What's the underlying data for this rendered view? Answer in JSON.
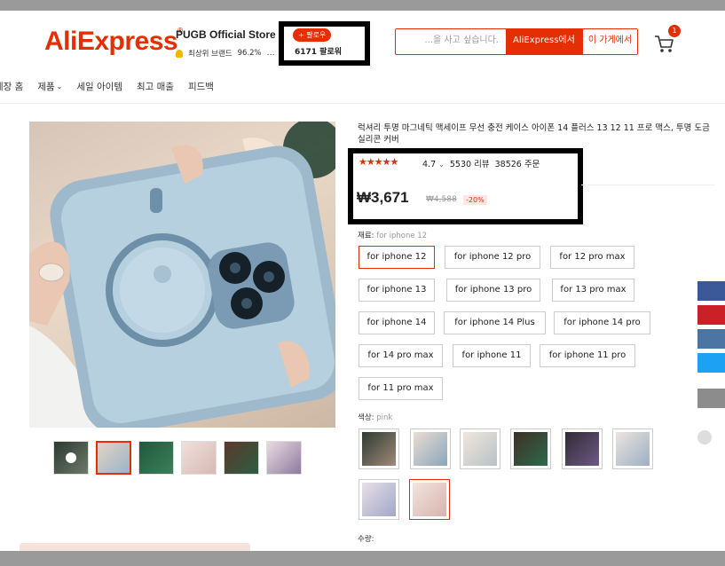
{
  "header": {
    "logo": "AliExpress",
    "store_name": "PUGB Official Store",
    "store_badge_text": "최상위 브랜드",
    "store_rating": "96.2%",
    "follow_label": "+ 팔로우",
    "followers": "6171 팔로워",
    "search_placeholder": "...을 사고 싶습니다.",
    "search_all": "AliExpress에서",
    "search_store": "이 가게에서",
    "cart_count": "1"
  },
  "nav": {
    "items": [
      "게장 홈",
      "제품",
      "세일 아이템",
      "최고 매출",
      "피드백"
    ]
  },
  "product": {
    "title": "럭셔리 투명 마그네틱 맥세이프 무선 충전 케이스 아이폰 14 플러스 13 12 11 프로 맥스, 투명 도금 실리콘 커버",
    "stars": "★★★★★",
    "rating": "4.7",
    "reviews": "5530 리뷰",
    "orders": "38526 주문",
    "price": "₩3,671",
    "old_price": "₩4,588",
    "discount": "-20%",
    "material_label": "재료:",
    "material_value": "for iphone 12",
    "materials": [
      "for iphone 12",
      "for iphone 12 pro",
      "for 12 pro max",
      "for iphone 13",
      "for iphone 13 pro",
      "for 13 pro max",
      "for iphone 14",
      "for iphone 14 Plus",
      "for iphone 14 pro",
      "for 14 pro max",
      "for iphone 11",
      "for iphone 11 pro",
      "for 11 pro max"
    ],
    "color_label": "색상:",
    "color_value": "pink",
    "quantity_label": "수량:"
  },
  "colors": {
    "brand": "#e62e04",
    "facebook": "#3b5998",
    "pinterest": "#cb2027",
    "vk": "#4c75a3",
    "twitter": "#1da1f2",
    "gray": "#8c8c8c"
  }
}
